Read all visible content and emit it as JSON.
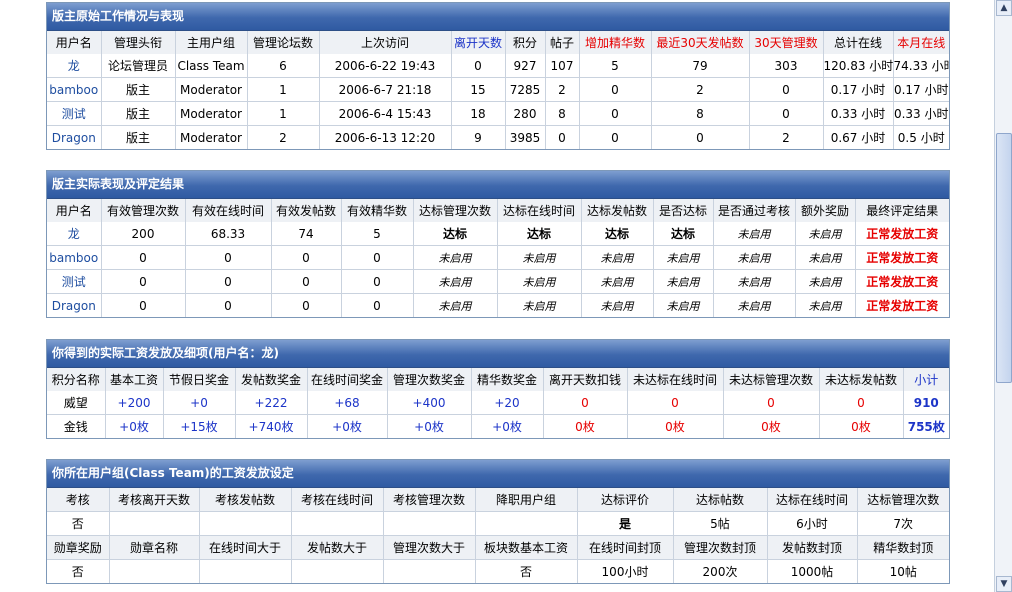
{
  "panel1": {
    "title": "版主原始工作情况与表现",
    "headers": [
      {
        "text": "用户名",
        "cls": ""
      },
      {
        "text": "管理头衔",
        "cls": ""
      },
      {
        "text": "主用户组",
        "cls": ""
      },
      {
        "text": "管理论坛数",
        "cls": ""
      },
      {
        "text": "上次访问",
        "cls": ""
      },
      {
        "text": "离开天数",
        "cls": "blue"
      },
      {
        "text": "积分",
        "cls": ""
      },
      {
        "text": "帖子",
        "cls": ""
      },
      {
        "text": "增加精华数",
        "cls": "red"
      },
      {
        "text": "最近30天发帖数",
        "cls": "red"
      },
      {
        "text": "30天管理数",
        "cls": "red"
      },
      {
        "text": "总计在线",
        "cls": ""
      },
      {
        "text": "本月在线",
        "cls": "red"
      }
    ],
    "rows": [
      [
        "龙",
        "论坛管理员",
        "Class Team",
        "6",
        "2006-6-22 19:43",
        "0",
        "927",
        "107",
        "5",
        "79",
        "303",
        "120.83 小时",
        "74.33 小时"
      ],
      [
        "bamboo",
        "版主",
        "Moderator",
        "1",
        "2006-6-7 21:18",
        "15",
        "7285",
        "2",
        "0",
        "2",
        "0",
        "0.17 小时",
        "0.17 小时"
      ],
      [
        "测试",
        "版主",
        "Moderator",
        "1",
        "2006-6-4 15:43",
        "18",
        "280",
        "8",
        "0",
        "8",
        "0",
        "0.33 小时",
        "0.33 小时"
      ],
      [
        "Dragon",
        "版主",
        "Moderator",
        "2",
        "2006-6-13 12:20",
        "9",
        "3985",
        "0",
        "0",
        "0",
        "2",
        "0.67 小时",
        "0.5 小时"
      ]
    ]
  },
  "panel2": {
    "title": "版主实际表现及评定结果",
    "headers": [
      "用户名",
      "有效管理次数",
      "有效在线时间",
      "有效发帖数",
      "有效精华数",
      "达标管理次数",
      "达标在线时间",
      "达标发帖数",
      "是否达标",
      "是否通过考核",
      "额外奖励",
      "最终评定结果"
    ],
    "rows": [
      [
        "龙",
        "200",
        "68.33",
        "74",
        "5",
        "达标",
        "达标",
        "达标",
        "达标",
        "未启用",
        "未启用",
        "正常发放工资"
      ],
      [
        "bamboo",
        "0",
        "0",
        "0",
        "0",
        "未启用",
        "未启用",
        "未启用",
        "未启用",
        "未启用",
        "未启用",
        "正常发放工资"
      ],
      [
        "测试",
        "0",
        "0",
        "0",
        "0",
        "未启用",
        "未启用",
        "未启用",
        "未启用",
        "未启用",
        "未启用",
        "正常发放工资"
      ],
      [
        "Dragon",
        "0",
        "0",
        "0",
        "0",
        "未启用",
        "未启用",
        "未启用",
        "未启用",
        "未启用",
        "未启用",
        "正常发放工资"
      ]
    ]
  },
  "panel3": {
    "title": "你得到的实际工资发放及细项(用户名：龙)",
    "headers": [
      "积分名称",
      "基本工资",
      "节假日奖金",
      "发帖数奖金",
      "在线时间奖金",
      "管理次数奖金",
      "精华数奖金",
      "离开天数扣钱",
      "未达标在线时间",
      "未达标管理次数",
      "未达标发帖数",
      "小计"
    ],
    "rows": [
      [
        "威望",
        "+200",
        "+0",
        "+222",
        "+68",
        "+400",
        "+20",
        "0",
        "0",
        "0",
        "0",
        "910"
      ],
      [
        "金钱",
        "+0枚",
        "+15枚",
        "+740枚",
        "+0枚",
        "+0枚",
        "+0枚",
        "0枚",
        "0枚",
        "0枚",
        "0枚",
        "755枚"
      ]
    ]
  },
  "panel4": {
    "title": "你所在用户组(Class Team)的工资发放设定",
    "row1_headers": [
      "考核",
      "考核离开天数",
      "考核发帖数",
      "考核在线时间",
      "考核管理次数",
      "降职用户组",
      "达标评价",
      "达标帖数",
      "达标在线时间",
      "达标管理次数"
    ],
    "row1_values": [
      "否",
      "",
      "",
      "",
      "",
      "",
      "是",
      "5帖",
      "6小时",
      "7次"
    ],
    "row2_headers": [
      "勋章奖励",
      "勋章名称",
      "在线时间大于",
      "发帖数大于",
      "管理次数大于",
      "板块数基本工资",
      "在线时间封顶",
      "管理次数封顶",
      "发帖数封顶",
      "精华数封顶"
    ],
    "row2_values": [
      "否",
      "",
      "",
      "",
      "",
      "否",
      "100小时",
      "200次",
      "1000帖",
      "10帖"
    ]
  },
  "scrollbar": {
    "up_icon": "▲",
    "down_icon": "▼"
  }
}
